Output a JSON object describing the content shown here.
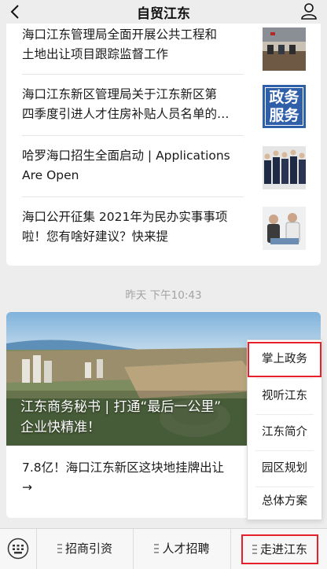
{
  "header": {
    "title": "自贸江东",
    "back_icon": "chevron-left-icon",
    "profile_icon": "person-icon"
  },
  "news_list": [
    {
      "title_line1": "海口江东管理局全面开展公共工程和",
      "title_line2": "土地出让项目跟踪监督工作",
      "thumb": "meeting-photo"
    },
    {
      "title_line1": "海口江东新区管理局关于江东新区第",
      "title_line2": "四季度引进人才住房补贴人员名单的…",
      "thumb": "government-service-badge",
      "badge_line1": "政务",
      "badge_line2": "服务"
    },
    {
      "title_line1": "哈罗海口招生全面启动 | Applications",
      "title_line2": "Are Open",
      "thumb": "students-photo"
    },
    {
      "title_line1": "海口公开征集 2021年为民办实事事项",
      "title_line2": "啦！您有啥好建议？快来提",
      "thumb": "people-photo"
    }
  ],
  "timestamp": "昨天 下午10:43",
  "feature_article": {
    "banner_line1": "江东商务秘书 | 打通“最后一公里”",
    "banner_line2": "企业快精准！",
    "item_line1": "7.8亿！海口江东新区这块地挂牌出让",
    "item_line2": "→"
  },
  "submenu": {
    "items": [
      "掌上政务",
      "视听江东",
      "江东简介",
      "园区规划",
      "总体方案"
    ],
    "highlighted_index": 0
  },
  "bottom_menu": {
    "keyboard_icon": "keyboard-icon",
    "tabs": [
      "招商引资",
      "人才招聘",
      "走进江东"
    ],
    "highlighted_index": 2
  },
  "colors": {
    "highlight": "#e8202a",
    "badge_blue": "#2f5fa8",
    "background": "#ededed"
  }
}
